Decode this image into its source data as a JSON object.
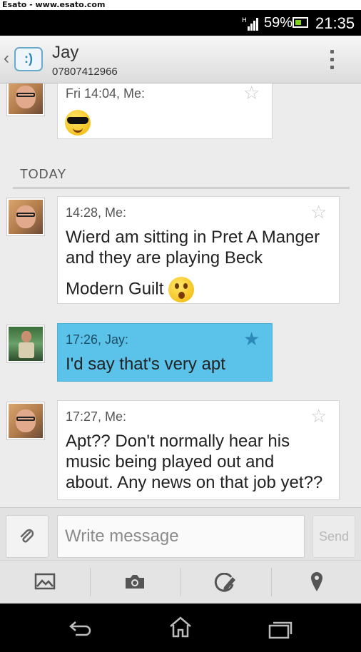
{
  "watermark": "Esato - www.esato.com",
  "status_bar": {
    "network": "H",
    "battery_percent": "59%",
    "battery_color": "#7ed321",
    "time": "21:35"
  },
  "header": {
    "contact_name": "Jay",
    "contact_number": "07807412966",
    "app_icon": ":)"
  },
  "conversation": {
    "date_divider": "TODAY",
    "messages": [
      {
        "meta": "Fri 14:04, Me:",
        "text": "",
        "emoji": "sunglasses-emoji",
        "sender": "me",
        "starred": false
      },
      {
        "meta": "14:28, Me:",
        "lines": [
          "Wierd am sitting in Pret A Manger",
          "and they are playing Beck",
          "Modern Guilt"
        ],
        "emoji": "surprised-emoji",
        "sender": "me",
        "starred": false
      },
      {
        "meta": "17:26, Jay:",
        "text": "I'd say that's very apt",
        "sender": "jay",
        "starred": true,
        "color": "#5bc2ea"
      },
      {
        "meta": "17:27, Me:",
        "lines": [
          "Apt?? Don't normally hear his",
          "music being played out and",
          "about. Any news on that job yet??"
        ],
        "sender": "me",
        "starred": false
      }
    ]
  },
  "composer": {
    "placeholder": "Write message",
    "send_label": "Send"
  },
  "attachment_bar": [
    "picture-icon",
    "camera-icon",
    "sketch-icon",
    "location-icon"
  ],
  "nav_bar": [
    "back-icon",
    "home-icon",
    "recent-apps-icon"
  ]
}
